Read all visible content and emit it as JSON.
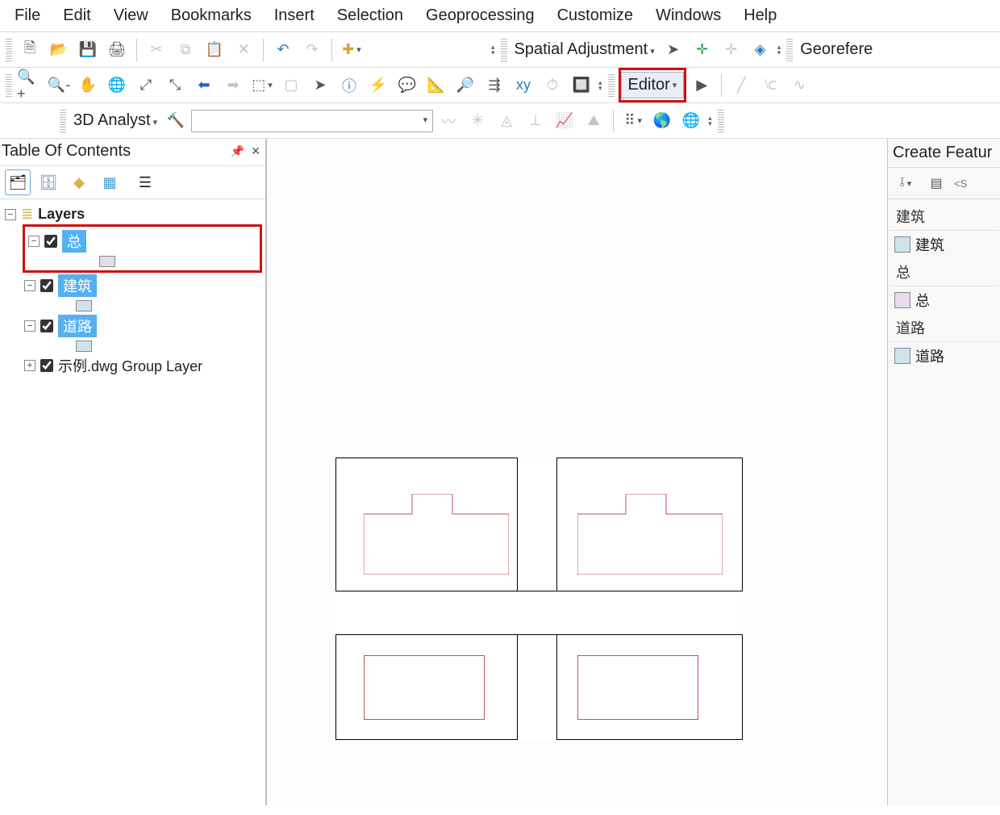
{
  "menu": [
    "File",
    "Edit",
    "View",
    "Bookmarks",
    "Insert",
    "Selection",
    "Geoprocessing",
    "Customize",
    "Windows",
    "Help"
  ],
  "toolbar1": {
    "spatial_adjust": "Spatial Adjustment",
    "georef": "Georefere"
  },
  "toolbar2": {
    "editor": "Editor"
  },
  "toolbar3": {
    "analyst": "3D Analyst"
  },
  "toc": {
    "title": "Table Of Contents",
    "root": "Layers",
    "layers": [
      {
        "name": "总",
        "swatch": "#e6dbe9",
        "selected": true
      },
      {
        "name": "建筑",
        "swatch": "#cfe3ef",
        "selected": false
      },
      {
        "name": "道路",
        "swatch": "#cfe3ef",
        "selected": false
      }
    ],
    "group_layer": "示例.dwg Group Layer"
  },
  "create_features": {
    "title": "Create Featur",
    "search_hint": "<S",
    "groups": [
      {
        "header": "建筑",
        "items": [
          {
            "label": "建筑",
            "swatch": "#cfe3ef"
          }
        ]
      },
      {
        "header": "总",
        "items": [
          {
            "label": "总",
            "swatch": "#e6dbe9"
          }
        ]
      },
      {
        "header": "道路",
        "items": [
          {
            "label": "道路",
            "swatch": "#cfe3ef"
          }
        ]
      }
    ]
  },
  "colors": {
    "highlight_red": "#c11",
    "sel_blue": "#55b0f0"
  }
}
